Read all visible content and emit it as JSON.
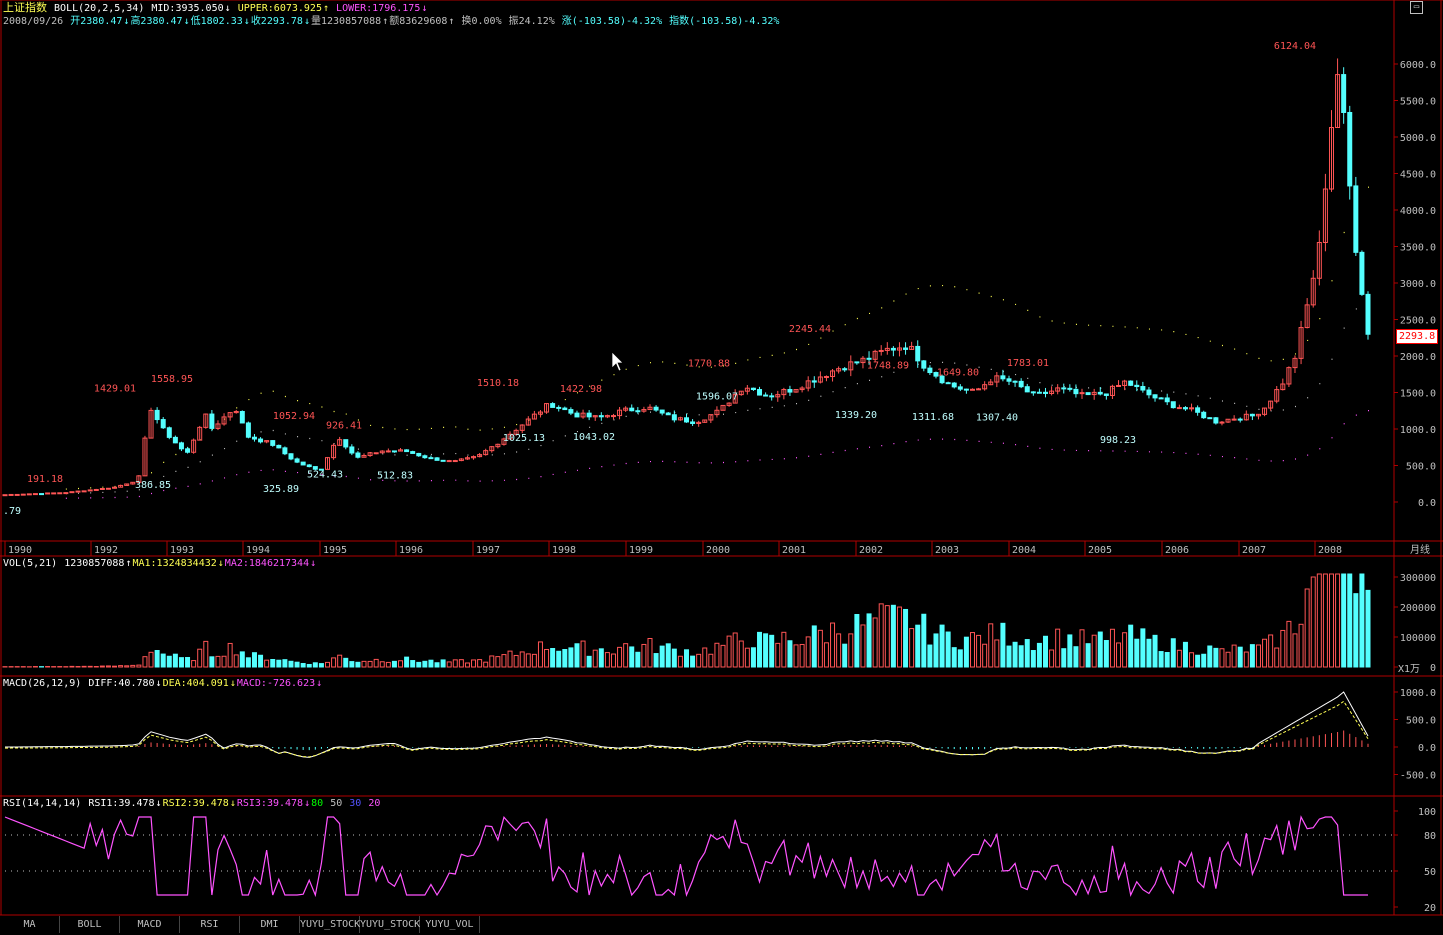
{
  "header": {
    "title": "上证指数",
    "indicator": "BOLL(20,2,5,34)",
    "mid": "MID:3935.050",
    "upper": "UPPER:6073.925",
    "lower": "LOWER:1796.175"
  },
  "quote": {
    "date": "2008/09/26",
    "open": "开2380.47",
    "high": "高2380.47",
    "low": "低1802.33",
    "close": "收2293.78",
    "volume": "量1230857088",
    "amount": "额83629608",
    "turnover": "换0.00%",
    "amplitude": "振24.12%",
    "change": "涨(-103.58)-4.32%",
    "index_change": "指数(-103.58)-4.32%"
  },
  "chart_data": {
    "type": "candlestick",
    "period_label": "月线",
    "price_axis": [
      "6000.0",
      "5500.0",
      "5000.0",
      "4500.0",
      "4000.0",
      "3500.0",
      "3000.0",
      "2500.0",
      "2000.0",
      "1500.0",
      "1000.0",
      "500.0",
      "0.0"
    ],
    "last_price_tag": "2293.8",
    "years": [
      "1990",
      "1992",
      "1993",
      "1994",
      "1995",
      "1996",
      "1997",
      "1998",
      "1999",
      "2000",
      "2001",
      "2002",
      "2003",
      "2004",
      "2005",
      "2006",
      "2007",
      "2008"
    ],
    "high_labels": [
      "191.18",
      "1429.01",
      "1558.95",
      "1052.94",
      "926.41",
      "1510.18",
      "1422.98",
      "1770.88",
      "2245.44",
      "1748.89",
      "1649.80",
      "1783.01",
      "6124.04"
    ],
    "low_labels": [
      ".79",
      "386.85",
      "325.89",
      "524.43",
      "512.83",
      "1025.13",
      "1043.02",
      "1596.07",
      "1339.20",
      "1311.68",
      "1307.40",
      "998.23"
    ]
  },
  "volume_panel": {
    "label": "VOL(5,21)",
    "value": "1230857088",
    "ma1": "MA1:1324834432",
    "ma2": "MA2:1846217344",
    "axis": [
      "300000",
      "200000",
      "100000",
      "0"
    ],
    "unit": "X1万"
  },
  "macd_panel": {
    "label": "MACD(26,12,9)",
    "diff": "DIFF:40.780",
    "dea": "DEA:404.091",
    "macd": "MACD:-726.623",
    "axis": [
      "1000.0",
      "500.0",
      "0.0",
      "-500.0"
    ]
  },
  "rsi_panel": {
    "label": "RSI(14,14,14)",
    "rsi1": "RSI1:39.478",
    "rsi2": "RSI2:39.478",
    "rsi3": "RSI3:39.478",
    "l80": "80",
    "l50": "50",
    "l30": "30",
    "l20": "20",
    "axis": [
      "100",
      "80",
      "50",
      "20"
    ]
  },
  "tabs": [
    "MA",
    "BOLL",
    "MACD",
    "RSI",
    "DMI",
    "YUYU_STOCK",
    "YUYU_STOCK",
    "YUYU_VOL"
  ],
  "colors": {
    "up": "#ff5555",
    "down": "#54ffff",
    "frame": "#b00000",
    "yellow": "#ffff54",
    "magenta": "#ff54ff"
  }
}
